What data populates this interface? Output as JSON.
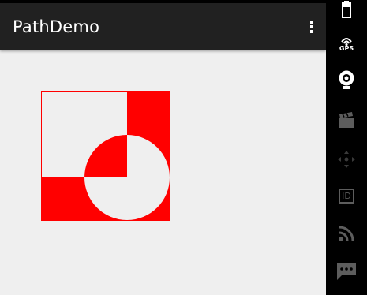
{
  "app": {
    "title": "PathDemo"
  },
  "app_bar": {
    "overflow_icon": "more-vert-icon"
  },
  "canvas": {
    "fill_color": "#ff0000",
    "background_color": "#efefef"
  },
  "side_panel": {
    "buttons": [
      {
        "icon": "battery-icon"
      },
      {
        "icon": "gps-icon",
        "label": "GPS"
      },
      {
        "icon": "webcam-icon"
      },
      {
        "icon": "movie-clapper-icon"
      },
      {
        "icon": "dpad-icon"
      },
      {
        "icon": "id-icon",
        "label": "ID"
      },
      {
        "icon": "rss-icon"
      },
      {
        "icon": "sms-icon"
      }
    ]
  }
}
